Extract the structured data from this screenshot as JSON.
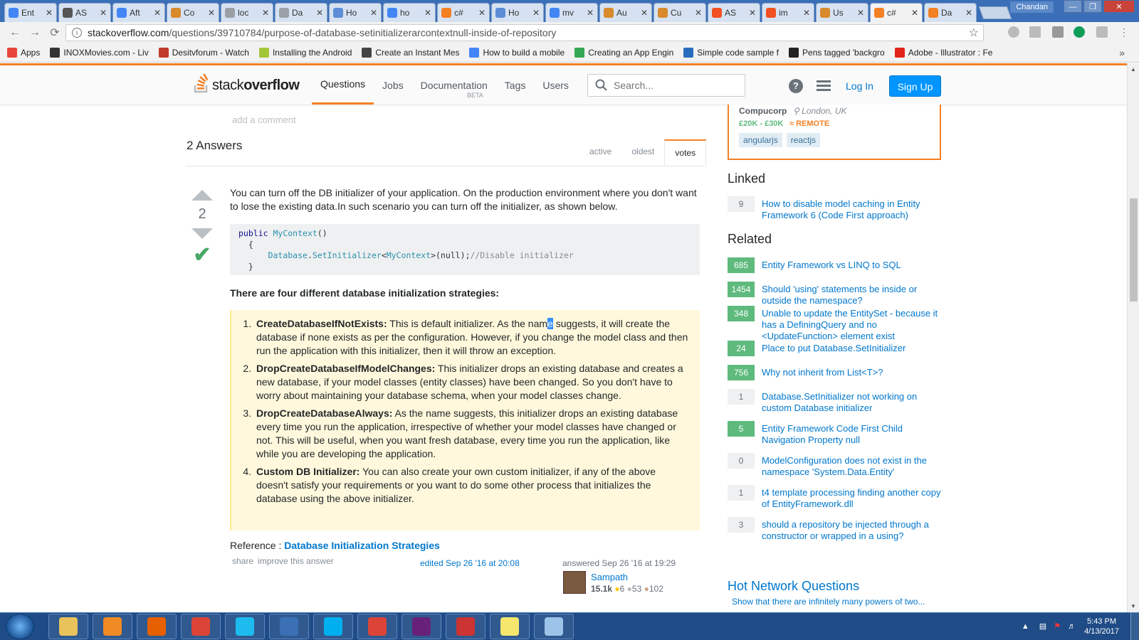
{
  "browser": {
    "tabs": [
      {
        "title": "Ent",
        "icon": "google-icon",
        "color": "#4285f4"
      },
      {
        "title": "AS",
        "icon": "hat-icon",
        "color": "#555555"
      },
      {
        "title": "Aft",
        "icon": "google-icon",
        "color": "#4285f4"
      },
      {
        "title": "Co",
        "icon": "stackoverflow-icon",
        "color": "#d88a2c"
      },
      {
        "title": "loc",
        "icon": "page-icon",
        "color": "#9aa0a6"
      },
      {
        "title": "Da",
        "icon": "page-icon",
        "color": "#9aa0a6"
      },
      {
        "title": "Ho",
        "icon": "page-icon",
        "color": "#5c8dd6"
      },
      {
        "title": "ho",
        "icon": "google-icon",
        "color": "#4285f4"
      },
      {
        "title": "c#",
        "icon": "stackoverflow-icon",
        "color": "#f48024"
      },
      {
        "title": "Ho",
        "icon": "page-icon",
        "color": "#5c8dd6"
      },
      {
        "title": "mv",
        "icon": "google-icon",
        "color": "#4285f4"
      },
      {
        "title": "Au",
        "icon": "stackoverflow-icon",
        "color": "#d88a2c"
      },
      {
        "title": "Cu",
        "icon": "stackoverflow-icon",
        "color": "#d88a2c"
      },
      {
        "title": "AS",
        "icon": "microsoft-icon",
        "color": "#f25022"
      },
      {
        "title": "im",
        "icon": "microsoft-icon",
        "color": "#f25022"
      },
      {
        "title": "Us",
        "icon": "stackoverflow-icon",
        "color": "#d88a2c"
      },
      {
        "title": "c#",
        "icon": "stackoverflow-icon",
        "color": "#f48024",
        "active": true
      },
      {
        "title": "Da",
        "icon": "stackoverflow-icon",
        "color": "#f48024"
      }
    ],
    "user": "Chandan",
    "url_host": "stackoverflow.com",
    "url_path": "/questions/39710784/purpose-of-database-setinitializerarcontextnull-inside-of-repository",
    "bookmarks": [
      {
        "label": "Apps",
        "color": "#e8453c"
      },
      {
        "label": "INOXMovies.com - Liv",
        "color": "#333333"
      },
      {
        "label": "Desitvforum - Watch",
        "color": "#c0392b"
      },
      {
        "label": "Installing the Android",
        "color": "#a4c639"
      },
      {
        "label": "Create an Instant Mes",
        "color": "#444444"
      },
      {
        "label": "How to build a mobile",
        "color": "#4285f4"
      },
      {
        "label": "Creating an App Engin",
        "color": "#34a853"
      },
      {
        "label": "Simple code sample f",
        "color": "#2a6dbd"
      },
      {
        "label": "Pens tagged 'backgro",
        "color": "#222222"
      },
      {
        "label": "Adobe - Illustrator : Fe",
        "color": "#e1251b"
      }
    ]
  },
  "so": {
    "logo_light": "stack",
    "logo_bold": "overflow",
    "nav": [
      "Questions",
      "Jobs",
      "Documentation",
      "Tags",
      "Users"
    ],
    "beta": "BETA",
    "search_placeholder": "Search...",
    "login": "Log In",
    "signup": "Sign Up"
  },
  "answers": {
    "add_comment": "add a comment",
    "count_label": "2 Answers",
    "sort_tabs": [
      "active",
      "oldest",
      "votes"
    ],
    "vote_count": "2",
    "intro": "You can turn off the DB initializer of your application. On the production environment where you don't want to lose the existing data.In such scenario you can turn off the initializer, as shown below.",
    "code_lines": {
      "l1_kw": "public",
      "l1_type": "MyContext",
      "l1_rest": "()",
      "l2": "{",
      "l3_type": "Database",
      "l3_dot": ".",
      "l3_method": "SetInitializer",
      "l3_lt": "<",
      "l3_generic": "MyContext",
      "l3_gt": ">(null);",
      "l3_comment": "//Disable initializer",
      "l4": "}"
    },
    "strategies_heading": "There are four different database initialization strategies:",
    "strategies": [
      {
        "title": "CreateDatabaseIfNotExists:",
        "text_pre": " This is default initializer. As the nam",
        "selected": "e",
        "text_post": " suggests, it will create the database if none exists as per the configuration. However, if you change the model class and then run the application with this initializer, then it will throw an exception."
      },
      {
        "title": "DropCreateDatabaseIfModelChanges:",
        "text": " This initializer drops an existing database and creates a new database, if your model classes (entity classes) have been changed. So you don't have to worry about maintaining your database schema, when your model classes change."
      },
      {
        "title": "DropCreateDatabaseAlways:",
        "text": " As the name suggests, this initializer drops an existing database every time you run the application, irrespective of whether your model classes have changed or not. This will be useful, when you want fresh database, every time you run the application, like while you are developing the application."
      },
      {
        "title": "Custom DB Initializer:",
        "text": " You can also create your own custom initializer, if any of the above doesn't satisfy your requirements or you want to do some other process that initializes the database using the above initializer."
      }
    ],
    "reference_label": "Reference : ",
    "reference_link": "Database Initialization Strategies",
    "share": "share",
    "improve": "improve this answer",
    "edited": "edited Sep 26 '16 at 20:08",
    "answered": "answered Sep 26 '16 at 19:29",
    "user_name": "Sampath",
    "user_rep": "15.1k",
    "gold": "6",
    "silver": "53",
    "bronze": "102"
  },
  "sidebar": {
    "job": {
      "company": "Compucorp",
      "location": "London, UK",
      "salary": "£20K - £30K",
      "remote": "REMOTE",
      "tags": [
        "angularjs",
        "reactjs"
      ]
    },
    "linked_title": "Linked",
    "linked": [
      {
        "score": "9",
        "accepted": false,
        "title": "How to disable model caching in Entity Framework 6 (Code First approach)"
      }
    ],
    "related_title": "Related",
    "related": [
      {
        "score": "685",
        "accepted": true,
        "title": "Entity Framework vs LINQ to SQL"
      },
      {
        "score": "1454",
        "accepted": true,
        "title": "Should 'using' statements be inside or outside the namespace?"
      },
      {
        "score": "348",
        "accepted": true,
        "title": "Unable to update the EntitySet - because it has a DefiningQuery and no <UpdateFunction> element exist"
      },
      {
        "score": "24",
        "accepted": true,
        "title": "Place to put Database.SetInitializer"
      },
      {
        "score": "756",
        "accepted": true,
        "title": "Why not inherit from List<T>?"
      },
      {
        "score": "1",
        "accepted": false,
        "title": "Database.SetInitializer not working on custom Database initializer"
      },
      {
        "score": "5",
        "accepted": true,
        "title": "Entity Framework Code First Child Navigation Property null"
      },
      {
        "score": "0",
        "accepted": false,
        "title": "ModelConfiguration does not exist in the namespace 'System.Data.Entity'"
      },
      {
        "score": "1",
        "accepted": false,
        "title": "t4 template processing finding another copy of EntityFramework.dll"
      },
      {
        "score": "3",
        "accepted": false,
        "title": "should a repository be injected through a constructor or wrapped in a using?"
      }
    ],
    "hnq_title": "Hot Network Questions",
    "hnq_first": "Show that there are infinitely many powers of two..."
  },
  "taskbar": {
    "apps": [
      {
        "name": "explorer-icon",
        "color": "#e8c25a"
      },
      {
        "name": "media-player-icon",
        "color": "#f08a24"
      },
      {
        "name": "firefox-icon",
        "color": "#e66000"
      },
      {
        "name": "chrome-icon",
        "color": "#db4437"
      },
      {
        "name": "ie-icon",
        "color": "#1ebbee"
      },
      {
        "name": "remote-desktop-icon",
        "color": "#3b6fb6"
      },
      {
        "name": "skype-icon",
        "color": "#00aff0"
      },
      {
        "name": "chrome-icon",
        "color": "#db4437"
      },
      {
        "name": "visual-studio-icon",
        "color": "#68217a"
      },
      {
        "name": "snipping-tool-icon",
        "color": "#cc3333"
      },
      {
        "name": "sticky-notes-icon",
        "color": "#f5e66e"
      },
      {
        "name": "notepad-icon",
        "color": "#9cc4e8"
      }
    ],
    "time": "5:43 PM",
    "date": "4/13/2017"
  }
}
